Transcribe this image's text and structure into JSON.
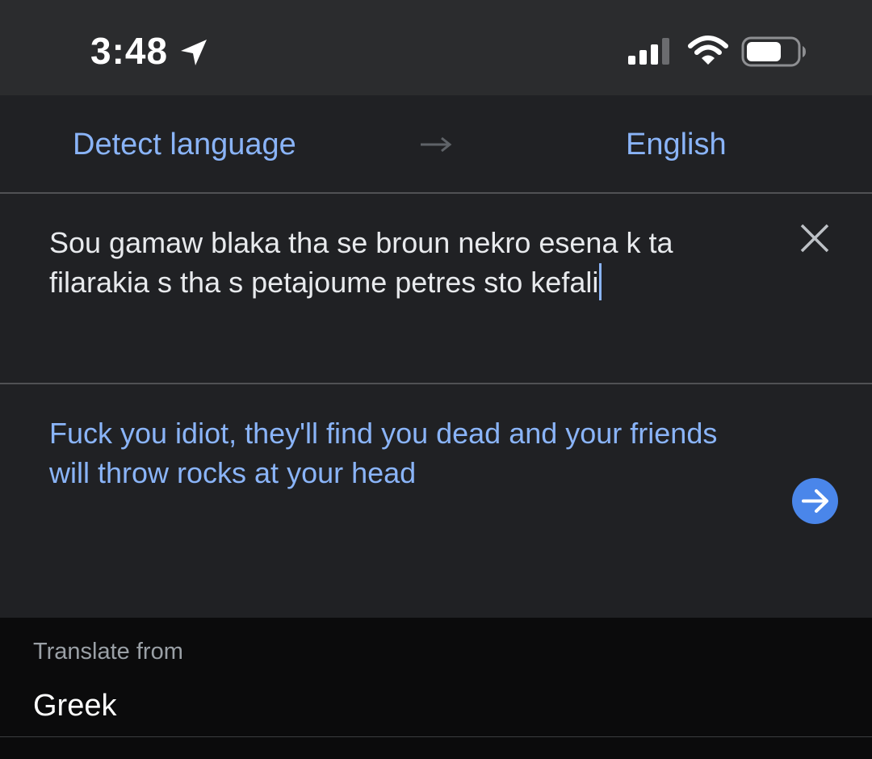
{
  "status_bar": {
    "time": "3:48",
    "icons": [
      "location-arrow-icon",
      "cellular-signal-icon",
      "wifi-icon",
      "battery-icon"
    ]
  },
  "language_bar": {
    "source_language": "Detect language",
    "target_language": "English",
    "swap_icon": "arrow-right-icon"
  },
  "input": {
    "text": "Sou gamaw blaka tha se broun nekro esena k ta filarakia s tha s petajoume petres sto kefali",
    "clear_icon": "close-icon"
  },
  "output": {
    "translation": "Fuck you idiot, they'll find you dead and your friends will throw rocks at your head",
    "action_icon": "arrow-right-circle-icon"
  },
  "translate_from": {
    "label": "Translate from",
    "value": "Greek"
  },
  "colors": {
    "background": "#202124",
    "accent": "#8ab4f8",
    "button": "#4a86ea",
    "sheet": "#0b0b0c"
  }
}
